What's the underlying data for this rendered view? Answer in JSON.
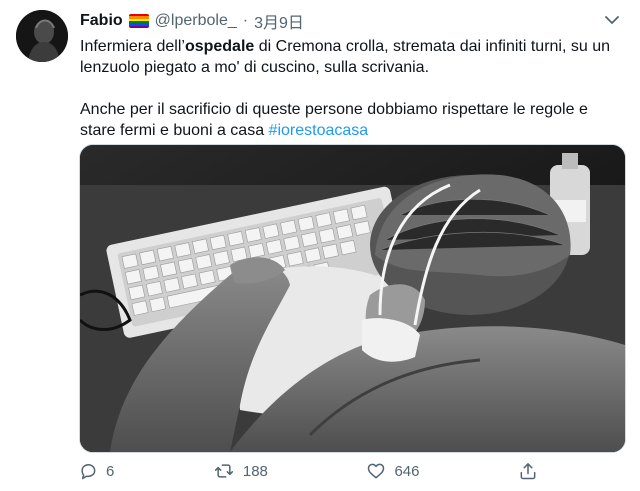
{
  "tweet": {
    "author": {
      "display_name": "Fabio",
      "flag_icon": "rainbow-flag-emoji",
      "handle": "@lperbole_"
    },
    "separator": "·",
    "date": "3月9日",
    "text": {
      "p1_before": "Infermiera dell’",
      "p1_bold": "ospedale",
      "p1_after": " di Cremona crolla, stremata dai infiniti turni, su un lenzuolo piegato a mo' di cuscino, sulla scrivania.",
      "p2_before": "Anche per il sacrificio di queste persone dobbiamo rispettare le regole e stare fermi e buoni a casa ",
      "p2_hashtag": "#iorestoacasa"
    },
    "media": {
      "description_icon": "photo"
    },
    "actions": {
      "replies": "6",
      "retweets": "188",
      "likes": "646"
    },
    "colors": {
      "accent": "#1d9bf0",
      "secondary_text": "#536471"
    }
  }
}
